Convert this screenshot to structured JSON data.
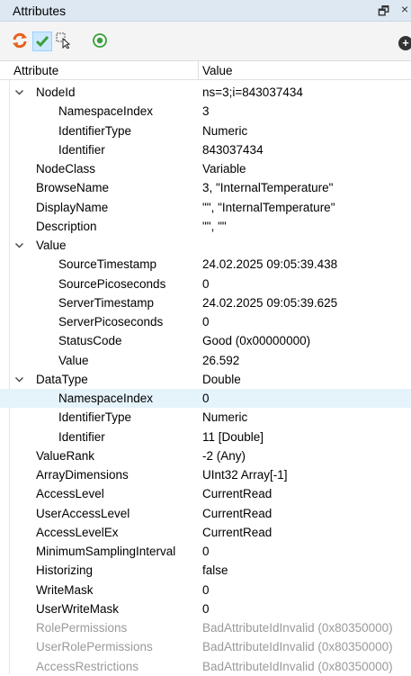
{
  "panel": {
    "title": "Attributes",
    "pin_glyph": "🗗",
    "close_glyph": "×"
  },
  "toolbar": {
    "icons": [
      "refresh-icon",
      "check-icon",
      "cursor-select-icon",
      "target-icon"
    ],
    "add_glyph": "+"
  },
  "header": {
    "attribute": "Attribute",
    "value": "Value"
  },
  "rows": [
    {
      "name": "NodeId",
      "value": "ns=3;i=843037434",
      "level": 0,
      "expanded": true
    },
    {
      "name": "NamespaceIndex",
      "value": "3",
      "level": 1
    },
    {
      "name": "IdentifierType",
      "value": "Numeric",
      "level": 1
    },
    {
      "name": "Identifier",
      "value": "843037434",
      "level": 1
    },
    {
      "name": "NodeClass",
      "value": "Variable",
      "level": 0
    },
    {
      "name": "BrowseName",
      "value": "3, \"InternalTemperature\"",
      "level": 0
    },
    {
      "name": "DisplayName",
      "value": "\"\", \"InternalTemperature\"",
      "level": 0
    },
    {
      "name": "Description",
      "value": "\"\", \"\"",
      "level": 0
    },
    {
      "name": "Value",
      "value": "",
      "level": 0,
      "expanded": true
    },
    {
      "name": "SourceTimestamp",
      "value": "24.02.2025 09:05:39.438",
      "level": 1
    },
    {
      "name": "SourcePicoseconds",
      "value": "0",
      "level": 1
    },
    {
      "name": "ServerTimestamp",
      "value": "24.02.2025 09:05:39.625",
      "level": 1
    },
    {
      "name": "ServerPicoseconds",
      "value": "0",
      "level": 1
    },
    {
      "name": "StatusCode",
      "value": "Good (0x00000000)",
      "level": 1
    },
    {
      "name": "Value",
      "value": "26.592",
      "level": 1
    },
    {
      "name": "DataType",
      "value": "Double",
      "level": 0,
      "expanded": true
    },
    {
      "name": "NamespaceIndex",
      "value": "0",
      "level": 1,
      "highlight": true
    },
    {
      "name": "IdentifierType",
      "value": "Numeric",
      "level": 1
    },
    {
      "name": "Identifier",
      "value": "11 [Double]",
      "level": 1
    },
    {
      "name": "ValueRank",
      "value": "-2 (Any)",
      "level": 0
    },
    {
      "name": "ArrayDimensions",
      "value": "UInt32 Array[-1]",
      "level": 0
    },
    {
      "name": "AccessLevel",
      "value": "CurrentRead",
      "level": 0
    },
    {
      "name": "UserAccessLevel",
      "value": "CurrentRead",
      "level": 0
    },
    {
      "name": "AccessLevelEx",
      "value": "CurrentRead",
      "level": 0
    },
    {
      "name": "MinimumSamplingInterval",
      "value": "0",
      "level": 0
    },
    {
      "name": "Historizing",
      "value": "false",
      "level": 0
    },
    {
      "name": "WriteMask",
      "value": "0",
      "level": 0
    },
    {
      "name": "UserWriteMask",
      "value": "0",
      "level": 0
    },
    {
      "name": "RolePermissions",
      "value": "BadAttributeIdInvalid (0x80350000)",
      "level": 0,
      "disabled": true
    },
    {
      "name": "UserRolePermissions",
      "value": "BadAttributeIdInvalid (0x80350000)",
      "level": 0,
      "disabled": true
    },
    {
      "name": "AccessRestrictions",
      "value": "BadAttributeIdInvalid (0x80350000)",
      "level": 0,
      "disabled": true
    }
  ]
}
